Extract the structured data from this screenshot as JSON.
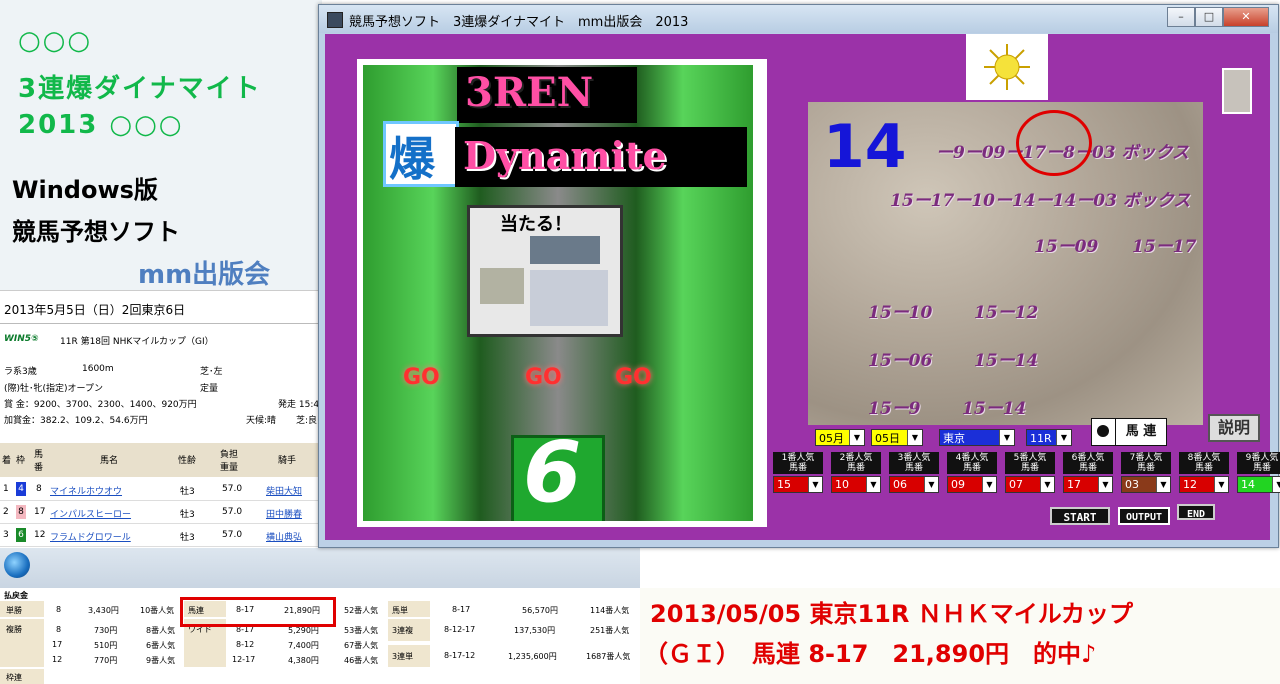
{
  "promo": {
    "line1": "○○○",
    "line2": "3連爆ダイナマイト",
    "line3": "2013 ○○○",
    "line4": "Windows版",
    "line5": "競馬予想ソフト",
    "brand": "mm出版会"
  },
  "racepage": {
    "date_line": "2013年5月5日（日）2回東京6日",
    "win5": "WIN5⑤",
    "race_title": "11R 第18回 NHKマイルカップ（GI）",
    "cond1": "ラ系3歳",
    "distance": "1600m",
    "course": "芝･左",
    "cond2": "(際)牡･牝(指定)オープン",
    "weight_rule": "定量",
    "prize": "賞 金：9200、3700、2300、1400、920万円",
    "post_time": "発走 15:4",
    "add_prize": "加賞金：382.2、109.2、54.6万円",
    "weather": "天候:晴",
    "track": "芝:良",
    "headers": [
      "着",
      "枠",
      "馬番",
      "馬名",
      "性齢",
      "負担重量",
      "騎手"
    ],
    "rows": [
      {
        "rank": "1",
        "waku": "4",
        "num": "8",
        "name": "マイネルホウオウ",
        "sex": "牡3",
        "kg": "57.0",
        "jockey": "柴田大知"
      },
      {
        "rank": "2",
        "waku": "8",
        "num": "17",
        "name": "インパルスヒーロー",
        "sex": "牡3",
        "kg": "57.0",
        "jockey": "田中勝春"
      },
      {
        "rank": "3",
        "waku": "6",
        "num": "12",
        "name": "フラムドグロワール",
        "sex": "牡3",
        "kg": "57.0",
        "jockey": "横山典弘"
      }
    ]
  },
  "payout": {
    "title": "払戻金",
    "tansho": {
      "label": "単勝",
      "num": "8",
      "amount": "3,430円",
      "pop": "10番人気"
    },
    "fukusho": {
      "label": "複勝",
      "nums": [
        "8",
        "17",
        "12"
      ],
      "amounts": [
        "730円",
        "510円",
        "770円"
      ],
      "pops": [
        "8番人気",
        "6番人気",
        "9番人気"
      ]
    },
    "wakuren_label": "枠連",
    "umaren": {
      "label": "馬連",
      "combo": "8-17",
      "amount": "21,890円",
      "pop": "52番人気"
    },
    "wide": {
      "label": "ワイド",
      "combos": [
        "8-17",
        "8-12",
        "12-17"
      ],
      "amounts": [
        "5,290円",
        "7,400円",
        "4,380円"
      ],
      "pops": [
        "53番人気",
        "67番人気",
        "46番人気"
      ]
    },
    "umatan": {
      "label": "馬単",
      "combo": "8-17",
      "amount": "56,570円",
      "pop": "114番人気"
    },
    "sanrenpuku": {
      "label": "3連複",
      "combo": "8-12-17",
      "amount": "137,530円",
      "pop": "251番人気"
    },
    "sanrentan": {
      "label": "3連単",
      "combo": "8-17-12",
      "amount": "1,235,600円",
      "pop": "1687番人気"
    }
  },
  "caption": {
    "line1": "2013/05/05 東京11R ＮＨＫマイルカップ",
    "line2": "（ＧＩ）　馬連 8-17　21,890円　的中♪"
  },
  "window": {
    "title": "競馬予想ソフト　3連爆ダイナマイト　mm出版会　2013",
    "min": "–",
    "max": "□",
    "close": "✕"
  },
  "slot": {
    "logo1": "3REN",
    "logo_baku": "爆",
    "logo2": "Dynamite",
    "atarul": "当たる！",
    "go": "GO",
    "digit": "6"
  },
  "prediction": {
    "big_number": "14",
    "line1": "ー9ー09ー17ー8ー03 ボックス",
    "line2": "15ー17ー10ー14ー14ー03 ボックス",
    "p1": "15ー09",
    "p2": "15ー17",
    "p3": "15ー10",
    "p4": "15ー12",
    "p5": "15ー06",
    "p6": "15ー14",
    "p7": "15ー9",
    "p8": "15ー14"
  },
  "controls": {
    "month": "05月",
    "day": "05日",
    "venue": "東京",
    "race": "11R",
    "baren_label": "馬 連",
    "help_label": "説明",
    "arrow": "▼",
    "start": "START",
    "output": "OUTPUT",
    "end": "END"
  },
  "popularity": [
    {
      "label1": "1番人気",
      "label2": "馬番",
      "value": "15",
      "color": "#d80000"
    },
    {
      "label1": "2番人気",
      "label2": "馬番",
      "value": "10",
      "color": "#d80000"
    },
    {
      "label1": "3番人気",
      "label2": "馬番",
      "value": "06",
      "color": "#d80000"
    },
    {
      "label1": "4番人気",
      "label2": "馬番",
      "value": "09",
      "color": "#d80000"
    },
    {
      "label1": "5番人気",
      "label2": "馬番",
      "value": "07",
      "color": "#d80000"
    },
    {
      "label1": "6番人気",
      "label2": "馬番",
      "value": "17",
      "color": "#d80000"
    },
    {
      "label1": "7番人気",
      "label2": "馬番",
      "value": "03",
      "color": "#8a3a1a"
    },
    {
      "label1": "8番人気",
      "label2": "馬番",
      "value": "12",
      "color": "#d80000"
    },
    {
      "label1": "9番人気",
      "label2": "馬番",
      "value": "14",
      "color": "#22d422"
    }
  ]
}
